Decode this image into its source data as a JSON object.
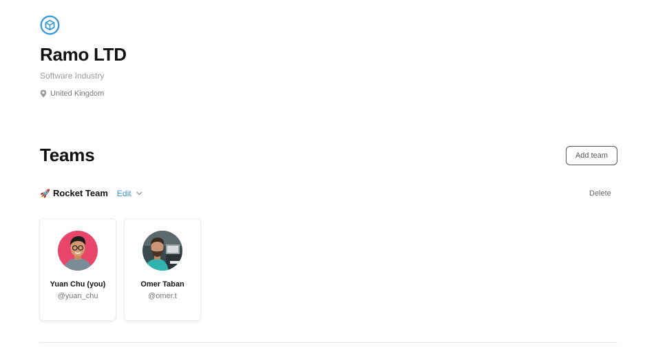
{
  "company": {
    "logo_icon": "cube-icon",
    "accent_color": "#3b9ad9",
    "name": "Ramo LTD",
    "industry": "Software Industry",
    "location_icon": "map-pin-icon",
    "location": "United Kingdom"
  },
  "teams_section": {
    "title": "Teams",
    "add_team_label": "Add team",
    "teams": [
      {
        "emoji": "🚀",
        "name": "Rocket Team",
        "edit_label": "Edit",
        "delete_label": "Delete",
        "members": [
          {
            "name": "Yuan Chu (you)",
            "handle": "@yuan_chu",
            "avatar_bg": "#e8456b"
          },
          {
            "name": "Omer Taban",
            "handle": "@omer.t",
            "avatar_bg": "#3b4a4f"
          }
        ]
      }
    ]
  }
}
